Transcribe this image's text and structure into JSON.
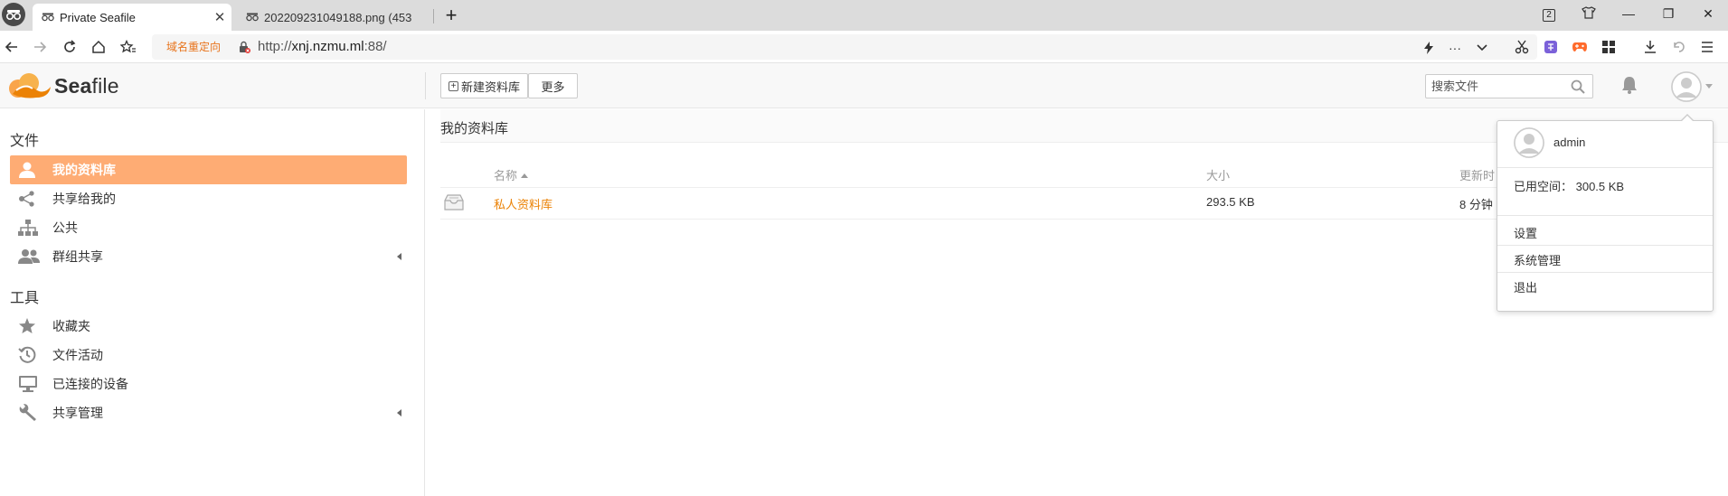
{
  "browser": {
    "tabs": [
      {
        "title": "Private Seafile",
        "active": true
      },
      {
        "title": "202209231049188.png (453",
        "active": false
      }
    ],
    "tab_count": "2",
    "redirect_label": "域名重定向",
    "url_prefix": "http://",
    "url_host": "xnj.nzmu.ml",
    "url_suffix": ":88/",
    "more_label": "···"
  },
  "header": {
    "logo_text_bold": "Sea",
    "logo_text_rest": "file",
    "new_library_label": "新建资料库",
    "more_label": "更多",
    "search_placeholder": "搜索文件"
  },
  "sidebar": {
    "files_heading": "文件",
    "files_items": [
      {
        "label": "我的资料库",
        "icon": "user-icon",
        "active": true
      },
      {
        "label": "共享给我的",
        "icon": "share-icon"
      },
      {
        "label": "公共",
        "icon": "org-chart-icon"
      },
      {
        "label": "群组共享",
        "icon": "group-icon",
        "expandable": true
      }
    ],
    "tools_heading": "工具",
    "tools_items": [
      {
        "label": "收藏夹",
        "icon": "star-icon"
      },
      {
        "label": "文件活动",
        "icon": "history-icon"
      },
      {
        "label": "已连接的设备",
        "icon": "monitor-icon"
      },
      {
        "label": "共享管理",
        "icon": "wrench-icon",
        "expandable": true
      }
    ]
  },
  "main": {
    "title": "我的资料库",
    "columns": {
      "name": "名称",
      "size": "大小",
      "updated": "更新时"
    },
    "rows": [
      {
        "name": "私人资料库",
        "size": "293.5 KB",
        "updated": "8 分钟"
      }
    ]
  },
  "account_popup": {
    "username": "admin",
    "space_used": "已用空间： 300.5 KB",
    "items": [
      "设置",
      "系统管理",
      "退出"
    ]
  },
  "colors": {
    "accent": "#feac74",
    "link": "#eb8205",
    "redirect": "#e8741c"
  }
}
